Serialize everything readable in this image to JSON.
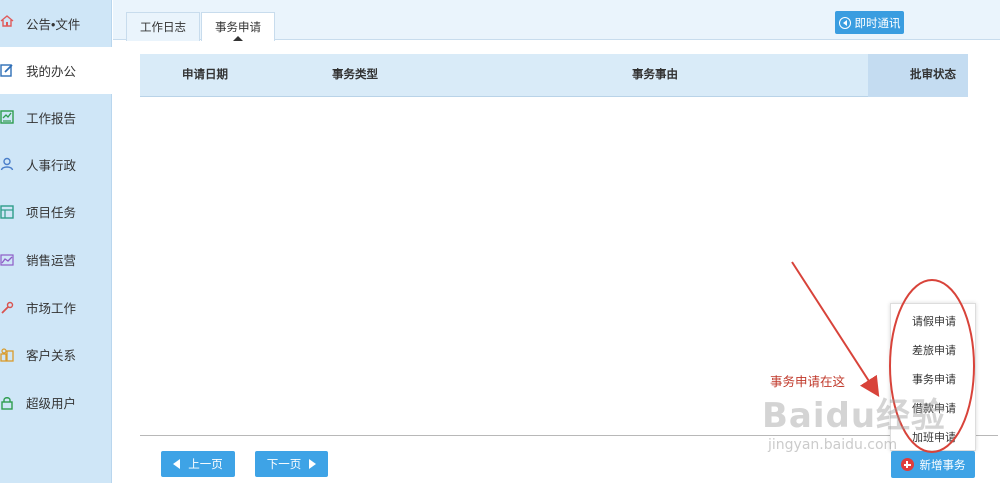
{
  "sidebar": {
    "items": [
      {
        "label": "公告•文件",
        "icon": "home-icon",
        "color": "#e05a5a"
      },
      {
        "label": "我的办公",
        "icon": "edit-icon",
        "color": "#2f6fb7"
      },
      {
        "label": "工作报告",
        "icon": "report-icon",
        "color": "#2e9d4f"
      },
      {
        "label": "人事行政",
        "icon": "user-icon",
        "color": "#4a7ec9"
      },
      {
        "label": "项目任务",
        "icon": "grid-icon",
        "color": "#2e9d8a"
      },
      {
        "label": "销售运营",
        "icon": "trend-icon",
        "color": "#8e5cc7"
      },
      {
        "label": "市场工作",
        "icon": "tool-icon",
        "color": "#d9534f"
      },
      {
        "label": "客户关系",
        "icon": "customers-icon",
        "color": "#d99b2b"
      },
      {
        "label": "超级用户",
        "icon": "lock-icon",
        "color": "#2e9d4f"
      }
    ]
  },
  "tabs": [
    {
      "label": "工作日志"
    },
    {
      "label": "事务申请"
    }
  ],
  "toolbar": {
    "im_label": "即时通讯"
  },
  "table": {
    "headers": [
      "申请日期",
      "事务类型",
      "事务事由",
      "批审状态"
    ],
    "rows": []
  },
  "pagination": {
    "prev_label": "上一页",
    "next_label": "下一页"
  },
  "new_button": {
    "label": "新增事务"
  },
  "dropdown": {
    "items": [
      "请假申请",
      "差旅申请",
      "事务申请",
      "借款申请",
      "加班申请"
    ]
  },
  "annotation": {
    "text": "事务申请在这"
  },
  "watermark": {
    "logo": "Baidu经验",
    "url": "jingyan.baidu.com"
  },
  "colors": {
    "sidebar_bg": "#cfe6f7",
    "accent": "#3ea3e6",
    "annotation": "#d8433a"
  }
}
